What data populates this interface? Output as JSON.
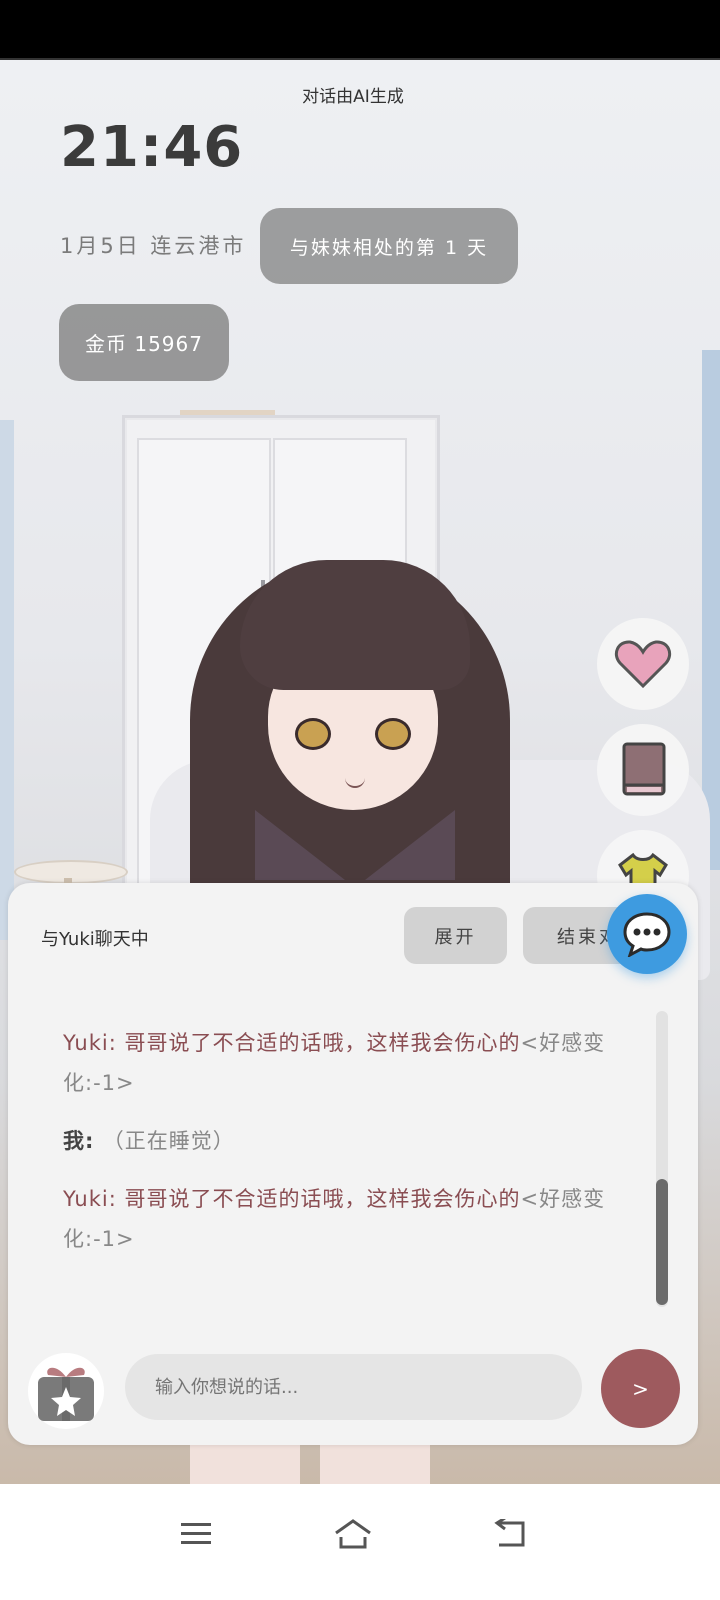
{
  "ai_note": "对话由AI生成",
  "time": "21:46",
  "date_location": "1月5日  连云港市",
  "day_badge": "与妹妹相处的第 1 天",
  "coins": "金币 15967",
  "side_buttons": [
    {
      "icon": "heart-icon",
      "color": "#e5a0b8"
    },
    {
      "icon": "book-icon",
      "color": "#8e6f74"
    },
    {
      "icon": "shirt-icon",
      "color": "#c8c441"
    }
  ],
  "chat": {
    "title": "与Yuki聊天中",
    "expand_label": "展开",
    "end_label": "结束对话",
    "messages": [
      {
        "speaker": "Yuki: ",
        "text": "哥哥说了不合适的话哦，这样我会伤心的",
        "meta": "<好感变化:-1>"
      },
      {
        "speaker": "我: ",
        "text": "（正在睡觉）",
        "meta": ""
      },
      {
        "speaker": "Yuki: ",
        "text": "哥哥说了不合适的话哦，这样我会伤心的",
        "meta": "<好感变化:-1>"
      }
    ],
    "input_placeholder": "输入你想说的话...",
    "send_label": ">"
  },
  "accent_color": "#9e5a5e",
  "fab_color": "#3e9be0"
}
